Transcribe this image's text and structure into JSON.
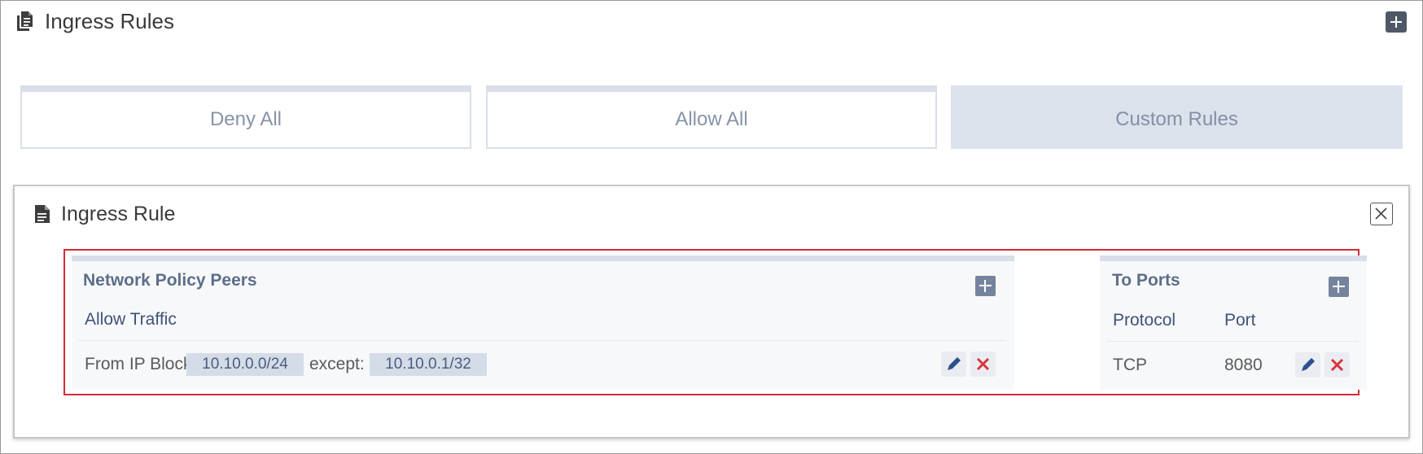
{
  "header": {
    "title": "Ingress Rules",
    "header_icon": "document-stack-icon",
    "add_icon": "plus-icon"
  },
  "modes": [
    {
      "label": "Deny All",
      "selected": false
    },
    {
      "label": "Allow All",
      "selected": false
    },
    {
      "label": "Custom Rules",
      "selected": true
    }
  ],
  "rule": {
    "title": "Ingress Rule",
    "title_icon": "document-icon",
    "close_icon": "close-icon",
    "peers": {
      "title": "Network Policy Peers",
      "subheading": "Allow Traffic",
      "row": {
        "from_label": "From IP Block:",
        "cidr": "10.10.0.0/24",
        "except_label": "except:",
        "except_cidr": "10.10.0.1/32"
      }
    },
    "ports": {
      "title": "To Ports",
      "columns": [
        "Protocol",
        "Port"
      ],
      "rows": [
        {
          "protocol": "TCP",
          "port": "8080"
        }
      ]
    }
  },
  "colors": {
    "highlight_border": "#d62a36",
    "accent_button": "#75849c",
    "delete_red": "#d9343c",
    "edit_blue": "#2d4f8e"
  }
}
